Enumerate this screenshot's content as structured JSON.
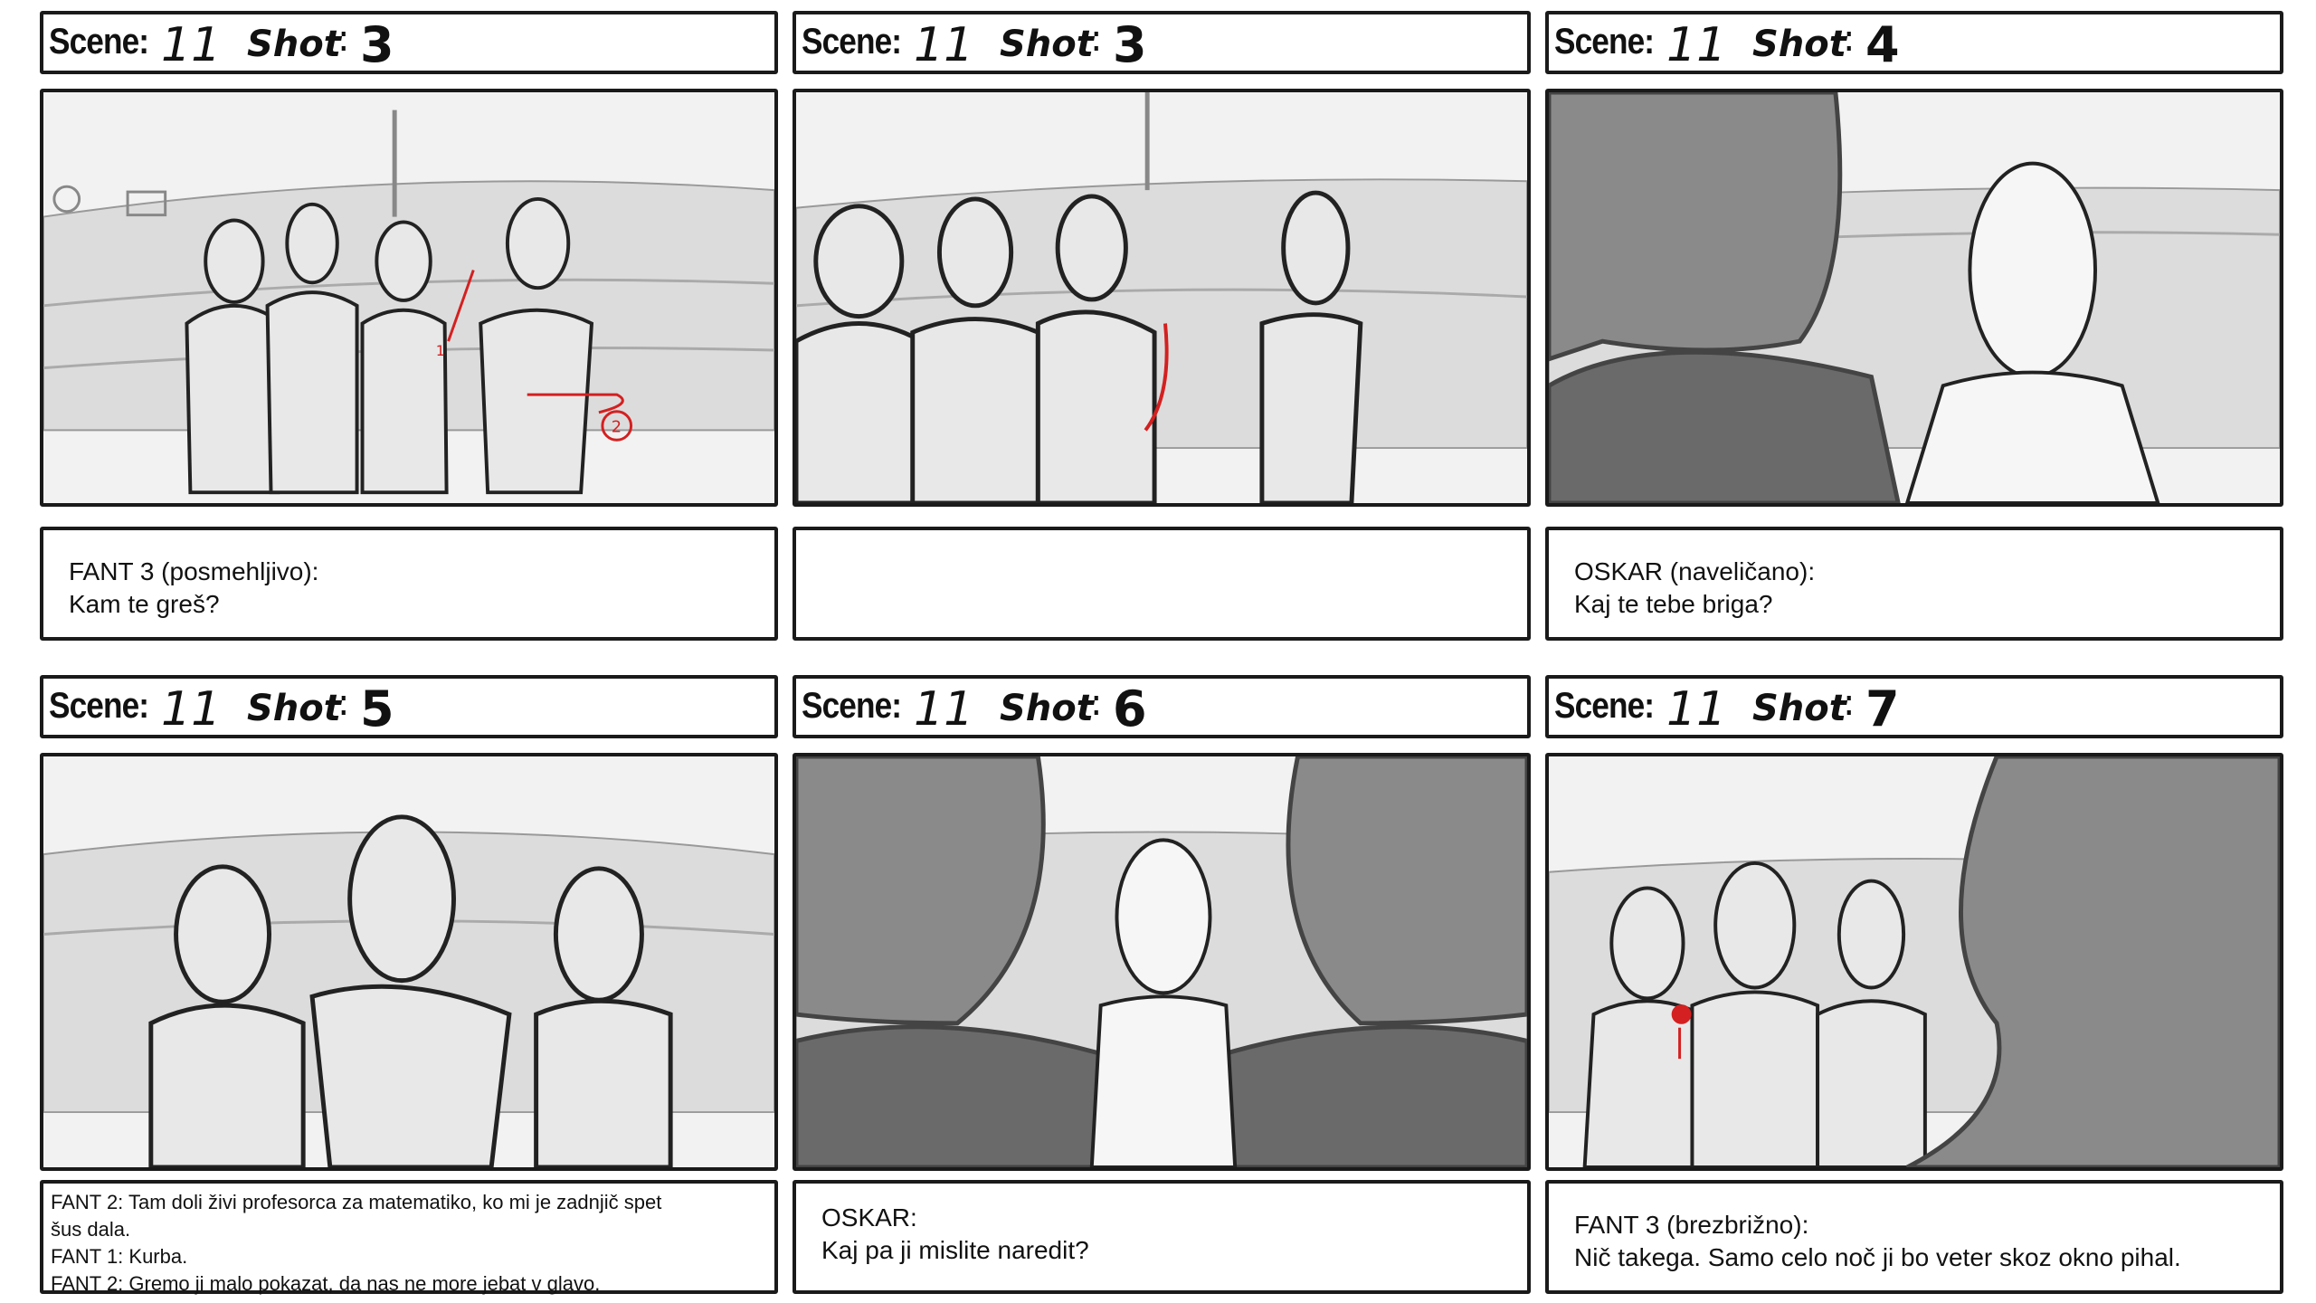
{
  "panels": [
    {
      "scene_label": "Scene:",
      "scene": "11",
      "shot_label": "Shot",
      "shot": "3",
      "caption": [
        "FANT 3 (posmehljivo):",
        "Kam te greš?"
      ],
      "annotations": [
        "1",
        "2"
      ]
    },
    {
      "scene_label": "Scene:",
      "scene": "11",
      "shot_label": "Shot",
      "shot": "3",
      "caption": []
    },
    {
      "scene_label": "Scene:",
      "scene": "11",
      "shot_label": "Shot",
      "shot": "4",
      "caption": [
        "OSKAR (naveličano):",
        "Kaj te tebe briga?"
      ]
    },
    {
      "scene_label": "Scene:",
      "scene": "11",
      "shot_label": "Shot",
      "shot": "5",
      "caption": [
        "FANT 2: Tam doli živi profesorca za matematiko, ko mi je zadnjič spet",
        "šus dala.",
        "FANT 1: Kurba.",
        "FANT 2: Gremo ji malo pokazat, da nas ne more jebat v glavo."
      ]
    },
    {
      "scene_label": "Scene:",
      "scene": "11",
      "shot_label": "Shot",
      "shot": "6",
      "caption": [
        "OSKAR:",
        "Kaj pa ji mislite naredit?"
      ]
    },
    {
      "scene_label": "Scene:",
      "scene": "11",
      "shot_label": "Shot",
      "shot": "7",
      "caption": [
        "FANT 3 (brezbrižno):",
        "Nič takega. Samo celo noč ji bo veter skoz okno pihal."
      ]
    }
  ],
  "colors": {
    "ink": "#1a1a1a",
    "sketch_fill": "#e6e6e6",
    "dark_fill": "#8a8a8a",
    "bg": "#f0f0f0",
    "red_annotation": "#d42020"
  }
}
